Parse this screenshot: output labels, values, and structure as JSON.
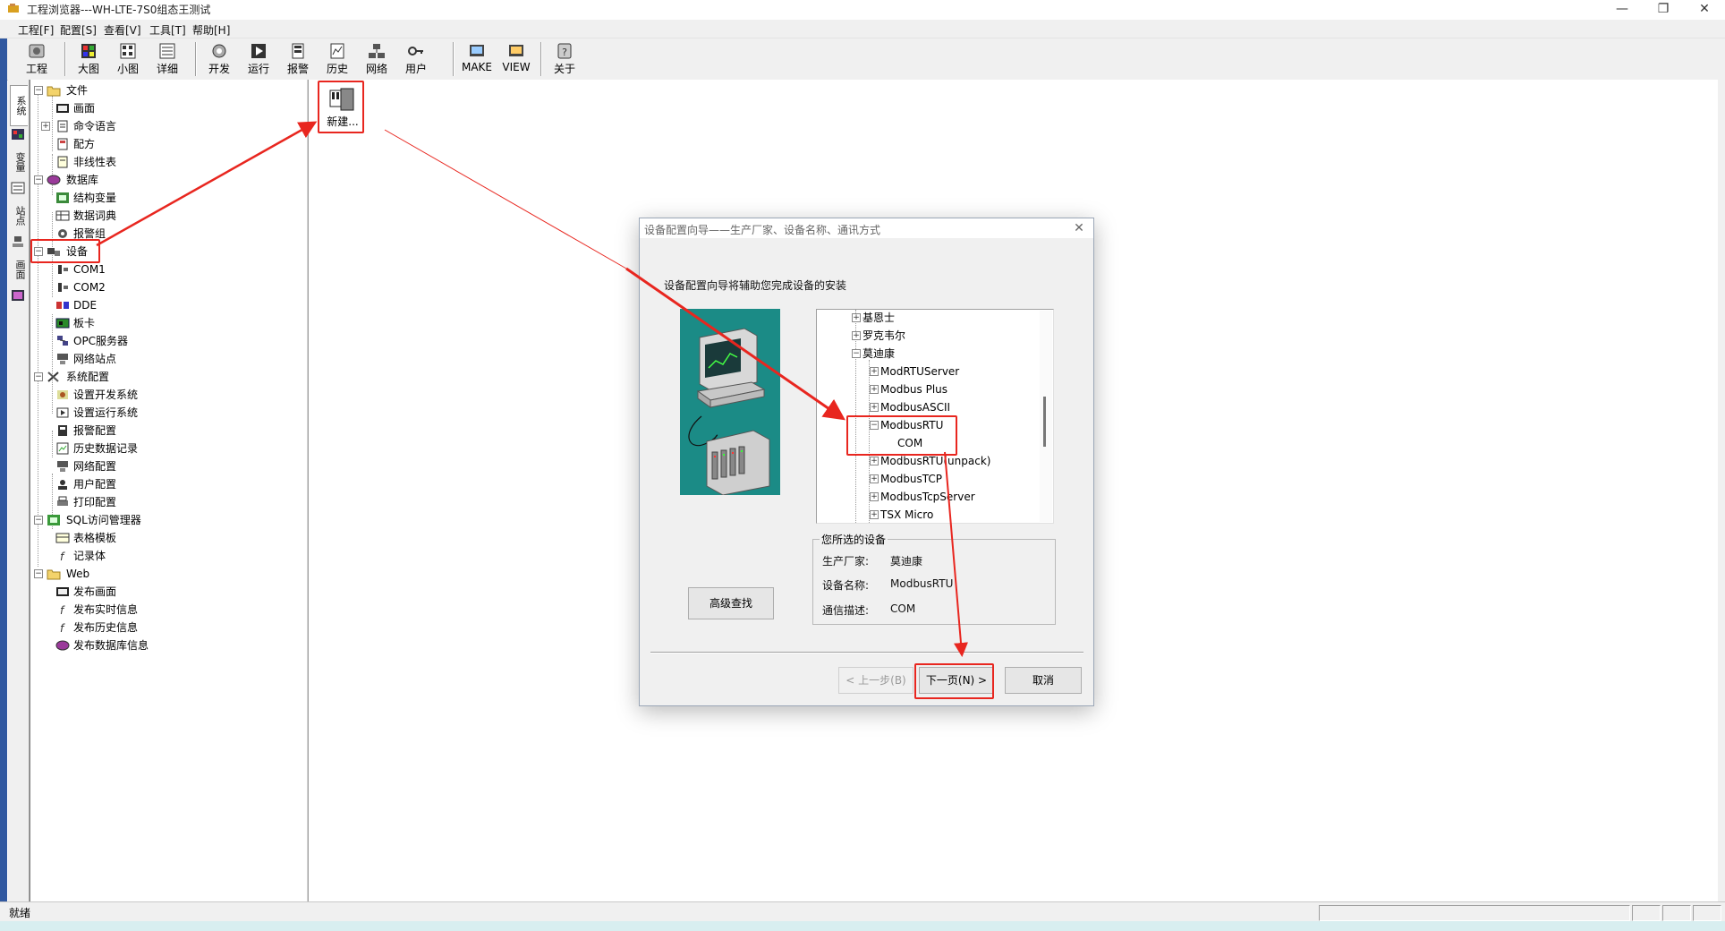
{
  "window": {
    "title": "工程浏览器---WH-LTE-7S0组态王测试",
    "controls": [
      "—",
      "❐",
      "✕"
    ]
  },
  "menubar": [
    "工程[F]",
    "配置[S]",
    "查看[V]",
    "工具[T]",
    "帮助[H]"
  ],
  "toolbar": {
    "groups": [
      [
        "工程"
      ],
      [
        "大图",
        "小图",
        "详细"
      ],
      [
        "开发",
        "运行",
        "报警",
        "历史",
        "网络",
        "用户"
      ],
      [
        "MAKE",
        "VIEW"
      ],
      [
        "关于"
      ]
    ]
  },
  "vtabs": [
    "系统",
    "变量",
    "站点",
    "画面"
  ],
  "tree": {
    "file": {
      "label": "文件",
      "children": [
        "画面",
        "命令语言",
        "配方",
        "非线性表"
      ]
    },
    "database": {
      "label": "数据库",
      "children": [
        "结构变量",
        "数据词典",
        "报警组"
      ]
    },
    "device": {
      "label": "设备",
      "children": [
        "COM1",
        "COM2",
        "DDE",
        "板卡",
        "OPC服务器",
        "网络站点"
      ]
    },
    "sysconfig": {
      "label": "系统配置",
      "children": [
        "设置开发系统",
        "设置运行系统",
        "报警配置",
        "历史数据记录",
        "网络配置",
        "用户配置",
        "打印配置"
      ]
    },
    "sql": {
      "label": "SQL访问管理器",
      "children": [
        "表格模板",
        "记录体"
      ]
    },
    "web": {
      "label": "Web",
      "children": [
        "发布画面",
        "发布实时信息",
        "发布历史信息",
        "发布数据库信息"
      ]
    }
  },
  "right_panel": {
    "new_item": "新建..."
  },
  "status": {
    "text": "就绪"
  },
  "dialog": {
    "title": "设备配置向导——生产厂家、设备名称、通讯方式",
    "intro": "设备配置向导将辅助您完成设备的安装",
    "device_tree": [
      {
        "label": "基恩士",
        "sign": "+",
        "level": 0
      },
      {
        "label": "罗克韦尔",
        "sign": "+",
        "level": 0
      },
      {
        "label": "莫迪康",
        "sign": "−",
        "level": 0
      },
      {
        "label": "ModRTUServer",
        "sign": "+",
        "level": 1
      },
      {
        "label": "Modbus Plus",
        "sign": "+",
        "level": 1
      },
      {
        "label": "ModbusASCII",
        "sign": "+",
        "level": 1
      },
      {
        "label": "ModbusRTU",
        "sign": "−",
        "level": 1
      },
      {
        "label": "COM",
        "sign": "",
        "level": 2
      },
      {
        "label": "ModbusRTU(unpack)",
        "sign": "+",
        "level": 1
      },
      {
        "label": "ModbusTCP",
        "sign": "+",
        "level": 1
      },
      {
        "label": "ModbusTcpServer",
        "sign": "+",
        "level": 1
      },
      {
        "label": "TSX Micro",
        "sign": "+",
        "level": 1
      }
    ],
    "selected_group": {
      "caption": "您所选的设备",
      "manufacturer_label": "生产厂家:",
      "manufacturer": "莫迪康",
      "device_label": "设备名称:",
      "device": "ModbusRTU",
      "comm_label": "通信描述:",
      "comm": "COM"
    },
    "advanced_search": "高级查找",
    "prev": "< 上一步(B)",
    "next": "下一页(N) >",
    "cancel": "取消"
  },
  "colors": {
    "annotation_red": "#e8261f",
    "left_strip": "#3058a0",
    "picture_teal": "#1b8b86"
  }
}
